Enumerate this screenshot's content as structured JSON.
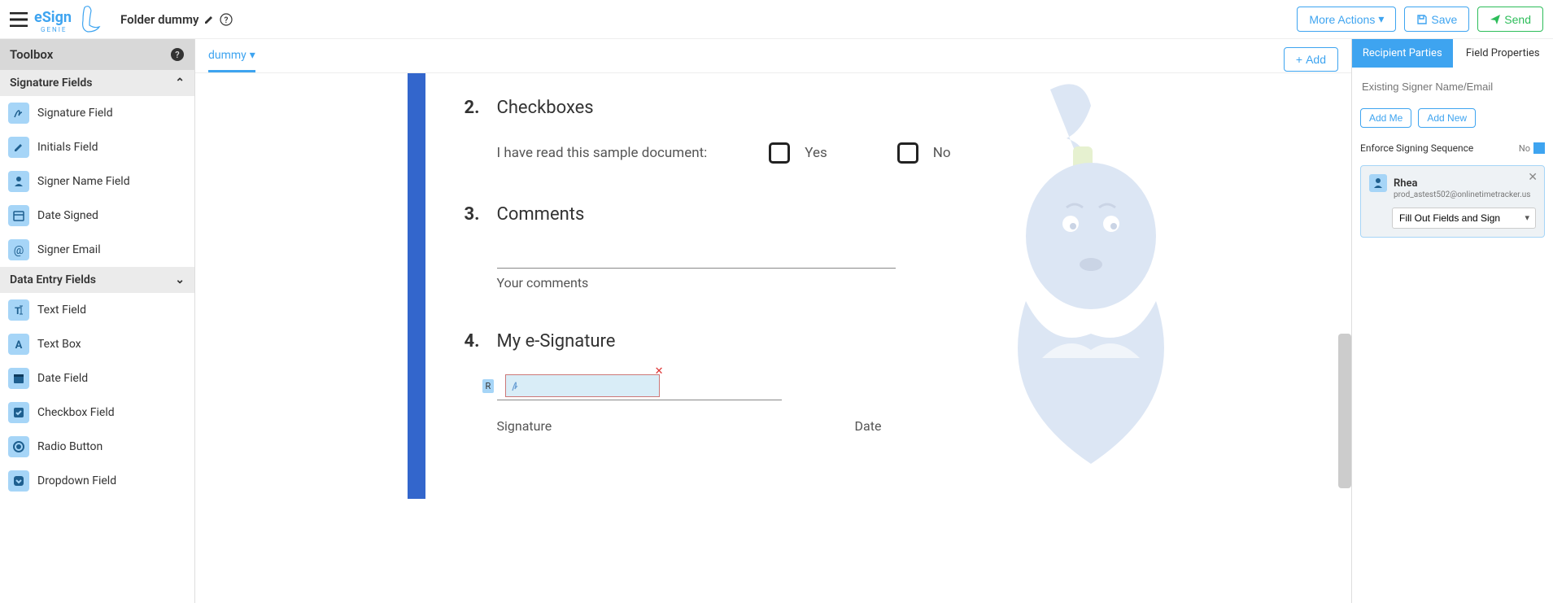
{
  "header": {
    "folder_label": "Folder dummy",
    "more_actions": "More Actions",
    "save": "Save",
    "send": "Send"
  },
  "toolbox": {
    "title": "Toolbox",
    "sections": {
      "signature": {
        "title": "Signature Fields",
        "items": [
          {
            "label": "Signature Field",
            "icon": "signature"
          },
          {
            "label": "Initials Field",
            "icon": "pencil"
          },
          {
            "label": "Signer Name Field",
            "icon": "user"
          },
          {
            "label": "Date Signed",
            "icon": "calendar"
          },
          {
            "label": "Signer Email",
            "icon": "at"
          }
        ]
      },
      "data": {
        "title": "Data Entry Fields",
        "items": [
          {
            "label": "Text Field",
            "icon": "text-cursor"
          },
          {
            "label": "Text Box",
            "icon": "letter-a"
          },
          {
            "label": "Date Field",
            "icon": "calendar"
          },
          {
            "label": "Checkbox Field",
            "icon": "check-square"
          },
          {
            "label": "Radio Button",
            "icon": "circle-dot"
          },
          {
            "label": "Dropdown Field",
            "icon": "chevron-down-box"
          }
        ]
      }
    }
  },
  "doc": {
    "tab_name": "dummy",
    "add_button": "Add",
    "sections": {
      "checkboxes": {
        "num": "2.",
        "title": "Checkboxes",
        "prompt": "I have read this sample document:",
        "yes": "Yes",
        "no": "No"
      },
      "comments": {
        "num": "3.",
        "title": "Comments",
        "hint": "Your comments"
      },
      "signature": {
        "num": "4.",
        "title": "My e-Signature",
        "sig_label": "Signature",
        "date_label": "Date",
        "tag": "R"
      }
    }
  },
  "right": {
    "tabs": {
      "recipients": "Recipient Parties",
      "properties": "Field Properties"
    },
    "signer_placeholder": "Existing Signer Name/Email",
    "add_me": "Add Me",
    "add_new": "Add New",
    "enforce_label": "Enforce Signing Sequence",
    "enforce_value": "No",
    "recipient": {
      "name": "Rhea",
      "email": "prod_astest502@onlinetimetracker.us",
      "role": "Fill Out Fields and Sign"
    }
  }
}
